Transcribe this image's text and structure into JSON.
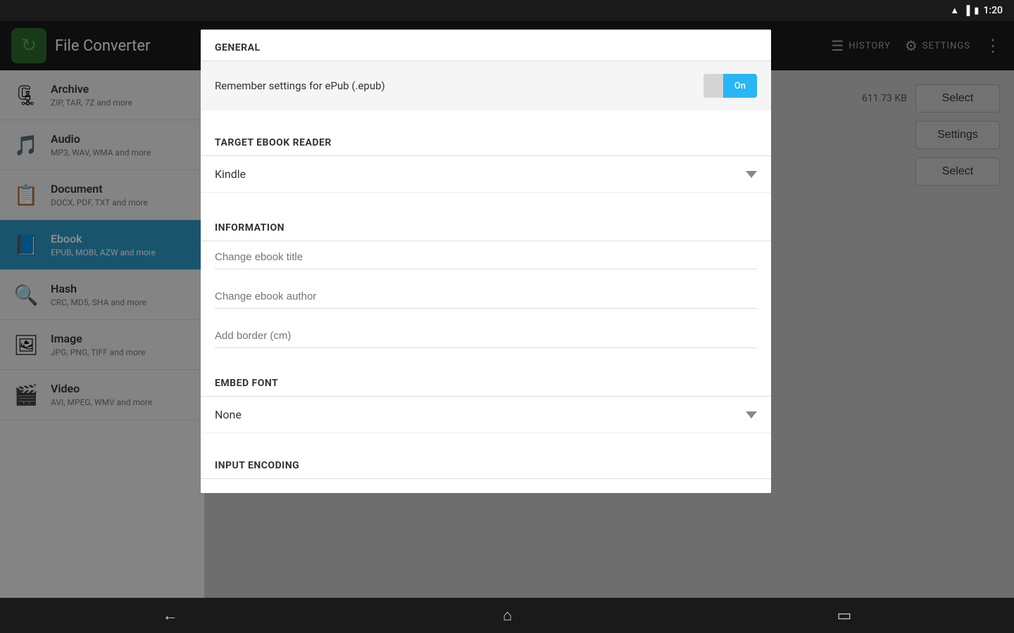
{
  "statusBar": {
    "time": "1:20",
    "wifiIcon": "wifi",
    "signalIcon": "signal",
    "batteryIcon": "battery"
  },
  "header": {
    "appName": "File Converter",
    "historyLabel": "HISTORY",
    "settingsLabel": "SETTINGS"
  },
  "sidebar": {
    "items": [
      {
        "id": "archive",
        "name": "Archive",
        "desc": "ZIP, TAR, 7Z and more",
        "icon": "🗜",
        "active": false
      },
      {
        "id": "audio",
        "name": "Audio",
        "desc": "MP3, WAV, WMA and more",
        "icon": "🎵",
        "active": false
      },
      {
        "id": "document",
        "name": "Document",
        "desc": "DOCX, PDF, TXT and more",
        "icon": "📋",
        "active": false
      },
      {
        "id": "ebook",
        "name": "Ebook",
        "desc": "EPUB, MOBI, AZW and more",
        "icon": "📘",
        "active": true
      },
      {
        "id": "hash",
        "name": "Hash",
        "desc": "CRC, MD5, SHA and more",
        "icon": "🔍",
        "active": false
      },
      {
        "id": "image",
        "name": "Image",
        "desc": "JPG, PNG, TIFF and more",
        "icon": "🖼",
        "active": false
      },
      {
        "id": "video",
        "name": "Video",
        "desc": "AVI, MPEG, WMV and more",
        "icon": "🎬",
        "active": false
      }
    ]
  },
  "rightContent": {
    "fileSize": "611.73 KB",
    "selectLabel1": "Select",
    "settingsLabel": "Settings",
    "selectLabel2": "Select"
  },
  "modal": {
    "sections": [
      {
        "id": "general",
        "header": "GENERAL",
        "settings": [
          {
            "id": "remember-settings",
            "label": "Remember settings for ePub (.epub)",
            "type": "toggle",
            "value": "On",
            "offLabel": "",
            "onLabel": "On"
          }
        ]
      },
      {
        "id": "target-ebook-reader",
        "header": "TARGET EBOOK READER",
        "dropdown": {
          "value": "Kindle"
        }
      },
      {
        "id": "information",
        "header": "INFORMATION",
        "inputs": [
          {
            "placeholder": "Change ebook title"
          },
          {
            "placeholder": "Change ebook author"
          },
          {
            "placeholder": "Add border (cm)"
          }
        ]
      },
      {
        "id": "embed-font",
        "header": "EMBED FONT",
        "dropdown": {
          "value": "None"
        }
      },
      {
        "id": "input-encoding",
        "header": "INPUT ENCODING"
      }
    ]
  },
  "bottomNav": {
    "backIcon": "←",
    "homeIcon": "⌂",
    "recentIcon": "▭"
  }
}
